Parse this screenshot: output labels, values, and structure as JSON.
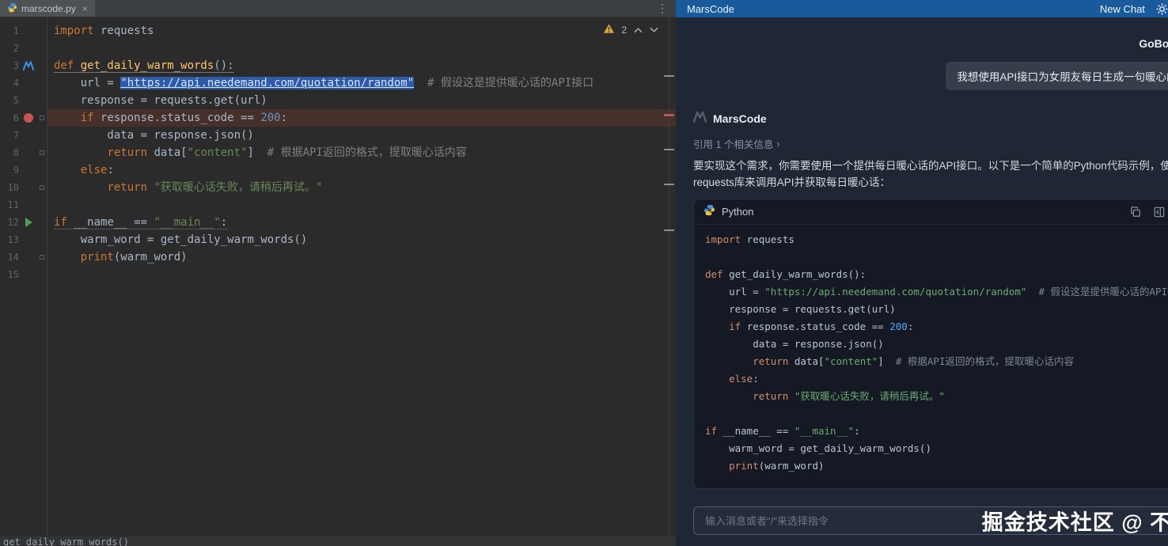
{
  "editor": {
    "tab_title": "marscode.py",
    "close_glyph": "×",
    "overflow_glyph": "⋮",
    "warning_count": "2",
    "breadcrumb": "get_daily_warm_words()"
  },
  "code": {
    "lines": [
      {
        "no": "1",
        "tokens": [
          {
            "t": "k",
            "v": "import"
          },
          {
            "t": "p",
            "v": " requests"
          }
        ]
      },
      {
        "no": "2",
        "tokens": []
      },
      {
        "no": "3",
        "icon": "marscode",
        "underline": "solid",
        "tokens": [
          {
            "t": "k",
            "v": "def "
          },
          {
            "t": "f",
            "v": "get_daily_warm_words"
          },
          {
            "t": "p",
            "v": "():"
          }
        ]
      },
      {
        "no": "4",
        "tokens": [
          {
            "t": "p",
            "v": "    url = "
          },
          {
            "t": "s",
            "v": "\"https://api.needemand.com/quotation/random\"",
            "sel": true
          },
          {
            "t": "p",
            "v": "  "
          },
          {
            "t": "c",
            "v": "# 假设这是提供暖心话的API接口"
          }
        ]
      },
      {
        "no": "5",
        "tokens": [
          {
            "t": "p",
            "v": "    response = requests.get(url)"
          }
        ]
      },
      {
        "no": "6",
        "icon": "breakpoint",
        "bp": true,
        "fold": true,
        "tokens": [
          {
            "t": "p",
            "v": "    "
          },
          {
            "t": "k",
            "v": "if "
          },
          {
            "t": "p",
            "v": "response.status_code == "
          },
          {
            "t": "n",
            "v": "200"
          },
          {
            "t": "p",
            "v": ":"
          }
        ]
      },
      {
        "no": "7",
        "tokens": [
          {
            "t": "p",
            "v": "        data = response.json()"
          }
        ]
      },
      {
        "no": "8",
        "fold": true,
        "tokens": [
          {
            "t": "p",
            "v": "        "
          },
          {
            "t": "k",
            "v": "return "
          },
          {
            "t": "p",
            "v": "data["
          },
          {
            "t": "s",
            "v": "\"content\""
          },
          {
            "t": "p",
            "v": "]  "
          },
          {
            "t": "c",
            "v": "# 根据API返回的格式，提取暖心话内容"
          }
        ]
      },
      {
        "no": "9",
        "tokens": [
          {
            "t": "p",
            "v": "    "
          },
          {
            "t": "k",
            "v": "else"
          },
          {
            "t": "p",
            "v": ":"
          }
        ]
      },
      {
        "no": "10",
        "fold": true,
        "tokens": [
          {
            "t": "p",
            "v": "        "
          },
          {
            "t": "k",
            "v": "return "
          },
          {
            "t": "s",
            "v": "\"获取暖心话失败，请稍后再试。\""
          }
        ]
      },
      {
        "no": "11",
        "tokens": []
      },
      {
        "no": "12",
        "icon": "run",
        "underline": "dotted",
        "tokens": [
          {
            "t": "k",
            "v": "if "
          },
          {
            "t": "p",
            "v": "__name__ == "
          },
          {
            "t": "s",
            "v": "\"__main__\""
          },
          {
            "t": "p",
            "v": ":"
          }
        ]
      },
      {
        "no": "13",
        "tokens": [
          {
            "t": "p",
            "v": "    warm_word = get_daily_warm_words()"
          }
        ]
      },
      {
        "no": "14",
        "fold": true,
        "tokens": [
          {
            "t": "p",
            "v": "    "
          },
          {
            "t": "k",
            "v": "print"
          },
          {
            "t": "p",
            "v": "(warm_word)"
          }
        ]
      },
      {
        "no": "15",
        "tokens": []
      }
    ]
  },
  "chat": {
    "header": {
      "title": "MarsCode",
      "new_chat": "New Chat",
      "minimize_glyph": "−"
    },
    "user": {
      "name": "GoBoy",
      "message": "我想使用API接口为女朋友每日生成一句暖心的话"
    },
    "assistant": {
      "name": "MarsCode",
      "reference": "引用 1 个相关信息",
      "reference_chevron": "›",
      "answer": "要实现这个需求，你需要使用一个提供每日暖心话的API接口。以下是一个简单的Python代码示例，使用了requests库来调用API并获取每日暖心话：",
      "code_lang": "Python"
    },
    "input": {
      "placeholder": "输入消息或者\"/\"来选择指令"
    },
    "watermark": "掘金技术社区 @ 不惑"
  },
  "colors": {
    "header_blue": "#195a9c",
    "breakpoint_red": "#c75450",
    "run_green": "#4e9d53",
    "selection_blue": "#2d5aa9",
    "avatar_green": "#36a353"
  }
}
